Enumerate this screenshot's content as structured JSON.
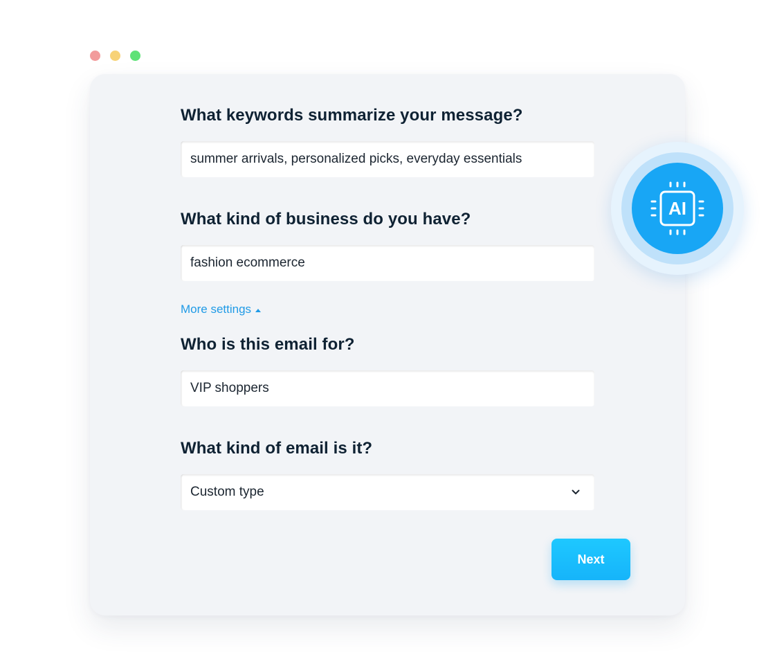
{
  "window": {
    "controls": [
      "close",
      "minimize",
      "maximize"
    ],
    "control_colors": {
      "close": "#f29b9b",
      "minimize": "#f7d277",
      "maximize": "#5fe277"
    }
  },
  "form": {
    "keywords": {
      "question": "What keywords summarize your message?",
      "value": "summer arrivals, personalized picks, everyday essentials"
    },
    "business": {
      "question": "What kind of business do you have?",
      "value": "fashion ecommerce"
    },
    "more_settings": {
      "label": "More settings",
      "icon": "caret-up-icon",
      "expanded": true
    },
    "audience": {
      "question": "Who is this email for?",
      "value": "VIP shoppers"
    },
    "email_type": {
      "question": "What kind of email is it?",
      "selected": "Custom type",
      "icon": "chevron-down-icon"
    },
    "next_label": "Next"
  },
  "ai_badge": {
    "label": "AI",
    "icon": "ai-chip-icon"
  },
  "colors": {
    "accent": "#1ec8ff",
    "link": "#1f9ae6",
    "heading": "#0f2233",
    "card_bg": "#f2f4f7",
    "badge_core": "#18a6f5"
  }
}
